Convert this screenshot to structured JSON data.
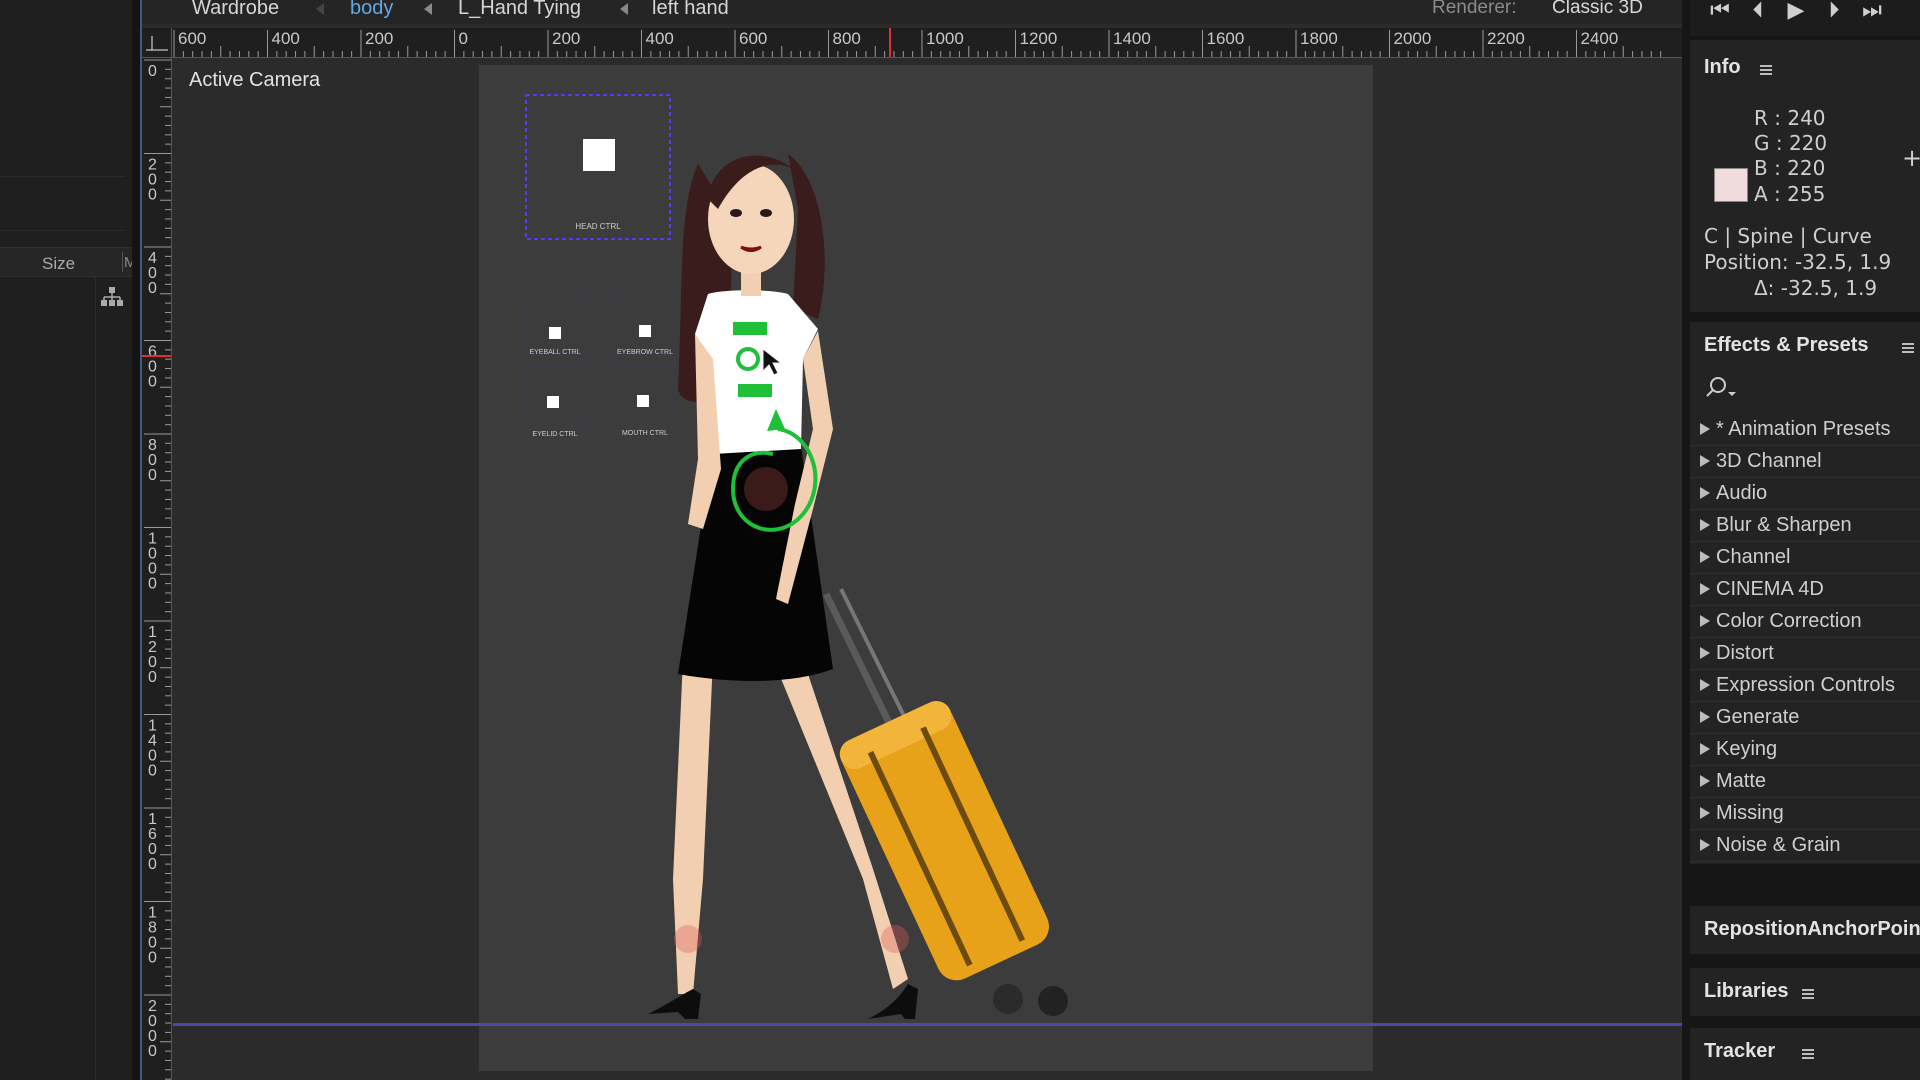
{
  "project": {
    "size_column_header": "Size",
    "next_column_header": "M"
  },
  "viewer": {
    "breadcrumbs": [
      {
        "label": "Wardrobe",
        "active": false
      },
      {
        "label": "body",
        "active": true
      },
      {
        "label": "L_Hand Tying",
        "active": false
      },
      {
        "label": "left hand",
        "active": false
      }
    ],
    "renderer_label": "Renderer:",
    "renderer_value": "Classic 3D",
    "camera_label": "Active Camera",
    "h_ruler_ticks": [
      "600",
      "400",
      "200",
      "0",
      "200",
      "400",
      "600",
      "800",
      "1000",
      "1200",
      "1400",
      "1600",
      "1800",
      "2000",
      "2200",
      "2400"
    ],
    "v_ruler_ticks": [
      "0",
      "200",
      "400",
      "600",
      "800",
      "1000",
      "1200",
      "1400",
      "1600",
      "1800",
      "2000"
    ]
  },
  "scene": {
    "controls": {
      "head": "HEAD CTRL",
      "eyeball": "EYEBALL CTRL",
      "eyebrow": "EYEBROW CTRL",
      "eyelid": "EYELID CTRL",
      "mouth": "MOUTH CTRL"
    },
    "colors": {
      "canvas": "#3c3c3c",
      "hair": "#3a1c1c",
      "skin": "#f2cfb0",
      "shirt": "#ffffff",
      "skirt": "#050505",
      "suitcase": "#e8a21a",
      "control_green": "#1fbf3a",
      "control_outline": "#5a3cf0",
      "ground_line": "#4d48a8"
    }
  },
  "info": {
    "title": "Info",
    "r": "R : 240",
    "g": "G : 220",
    "b": "B : 220",
    "a": "A : 255",
    "swatch_color": "#f0dcdc",
    "layer_line": "C | Spine | Curve",
    "position_line": "Position: -32.5, 1.9",
    "delta_line": "Δ: -32.5, 1.9"
  },
  "effects": {
    "title": "Effects & Presets",
    "search_icon": "search-icon",
    "categories": [
      "* Animation Presets",
      "3D Channel",
      "Audio",
      "Blur & Sharpen",
      "Channel",
      "CINEMA 4D",
      "Color Correction",
      "Distort",
      "Expression Controls",
      "Generate",
      "Keying",
      "Matte",
      "Missing",
      "Noise & Grain"
    ]
  },
  "panels": {
    "reposition": "RepositionAnchorPoint",
    "libraries": "Libraries",
    "tracker": "Tracker"
  }
}
